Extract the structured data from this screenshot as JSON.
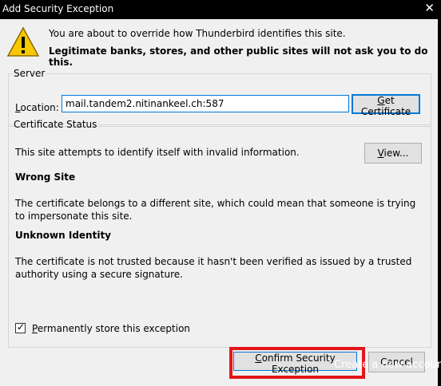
{
  "window": {
    "title": "Add Security Exception",
    "close_glyph": "✕"
  },
  "header": {
    "line1": "You are about to override how Thunderbird identifies this site.",
    "line2": "Legitimate banks, stores, and other public sites will not ask you to do this."
  },
  "server": {
    "legend": "Server",
    "location_label_prefix": "",
    "location_label_u": "L",
    "location_label_rest": "ocation:",
    "location_value": "mail.tandem2.nitinankeel.ch:587",
    "get_cert_u": "G",
    "get_cert_rest": "et Certificate"
  },
  "status": {
    "legend": "Certificate Status",
    "intro": "This site attempts to identify itself with invalid information.",
    "view_u": "V",
    "view_rest": "iew...",
    "wrong_site_title": "Wrong Site",
    "wrong_site_text": "The certificate belongs to a different site, which could mean that someone is trying to impersonate this site.",
    "unknown_title": "Unknown Identity",
    "unknown_text": "The certificate is not trusted because it hasn't been verified as issued by a trusted authority using a secure signature."
  },
  "permanent": {
    "checked": true,
    "label_u": "P",
    "label_rest": "ermanently store this exception"
  },
  "buttons": {
    "confirm_u": "C",
    "confirm_rest": "onfirm Security Exception",
    "cancel": "Cancel"
  },
  "background_text": "Create a new accoun",
  "colors": {
    "highlight": "#e3151a",
    "focus": "#0078d7",
    "warning": "#f9c800"
  },
  "icons": {
    "warning": "warning-icon",
    "close": "close-icon",
    "check": "check-icon"
  }
}
